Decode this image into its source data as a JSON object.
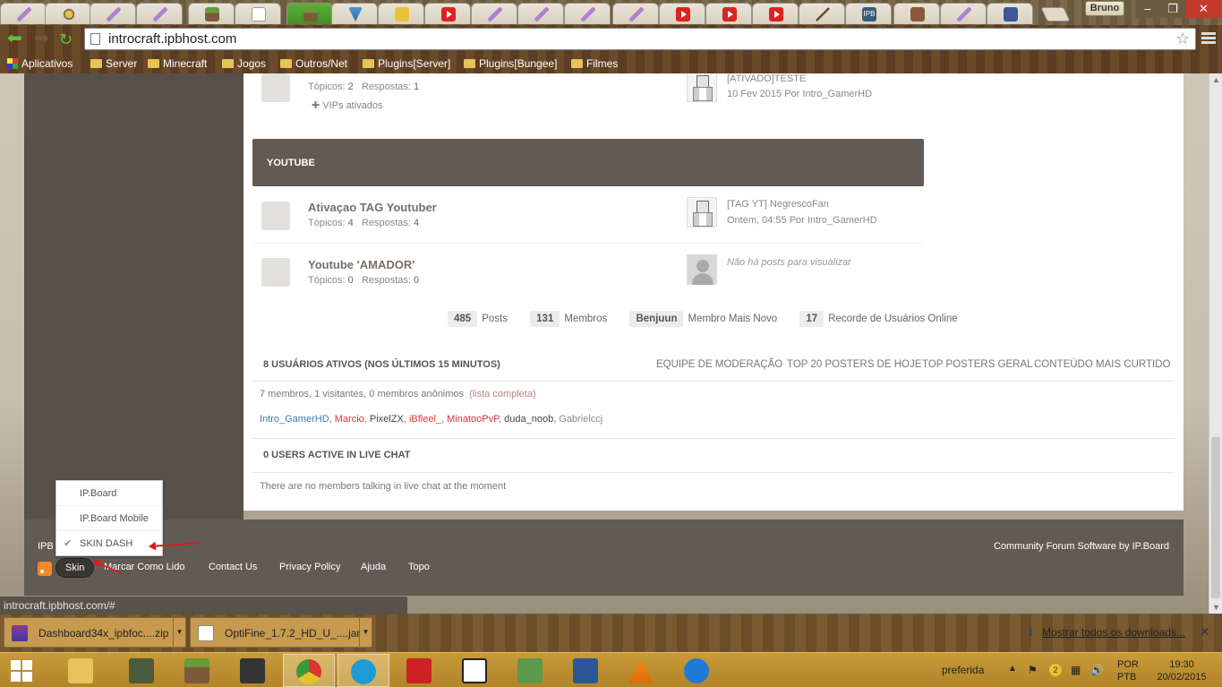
{
  "browser": {
    "profile_name": "Bruno",
    "url": "introcraft.ipbhost.com",
    "bookmarks": [
      "Aplicativos",
      "Server",
      "Minecraft",
      "Jogos",
      "Outros/Net",
      "Plugins[Server]",
      "Plugins[Bungee]",
      "Filmes"
    ],
    "status_url": "introcraft.ipbhost.com/#"
  },
  "forums_top": {
    "stats": {
      "topics_label": "Tópicos:",
      "topics": "2",
      "replies_label": "Respostas:",
      "replies": "1"
    },
    "subforum": "VIPs ativados",
    "last_title": "[ATIVADO]TESTE",
    "last_date": "10 Fev 2015",
    "last_by": "Por",
    "last_author": "Intro_GamerHD"
  },
  "youtube_section": {
    "header": "YOUTUBE",
    "forums": [
      {
        "title": "Ativaçao TAG Youtuber",
        "topics": "4",
        "replies": "4",
        "last_title": "[TAG YT] NegrescoFan",
        "last_date": "Ontem, 04:55",
        "last_by": "Por",
        "last_author": "Intro_GamerHD"
      },
      {
        "title": "Youtube 'AMADOR'",
        "topics": "0",
        "replies": "0",
        "last_title": "Não há posts para visualizar"
      }
    ],
    "topics_label": "Tópicos:",
    "replies_label": "Respostas:"
  },
  "board_stats": [
    {
      "value": "485",
      "label": "Posts"
    },
    {
      "value": "131",
      "label": "Membros"
    },
    {
      "value": "Benjuun",
      "label": "Membro Mais Novo"
    },
    {
      "value": "17",
      "label": "Recorde de Usuários Online"
    }
  ],
  "active_users": {
    "title": "8 USUÁRIOS ATIVOS (NOS ÚLTIMOS 15 MINUTOS)",
    "links": [
      "EQUIPE DE MODERAÇÃO",
      "TOP 20 POSTERS DE HOJE",
      "TOP POSTERS GERAL",
      "CONTEÚDO MAIS CURTIDO"
    ],
    "summary": "7 membros, 1 visitantes, 0 membros anônimos",
    "full_list": "(lista completa)",
    "users": [
      "Intro_GamerHD",
      "Marcio",
      "PixelZX",
      "iBfleel_",
      "MinatooPvP",
      "duda_noob",
      "Gabrielccj"
    ]
  },
  "live_chat": {
    "title": "0 USERS ACTIVE IN LIVE CHAT",
    "text": "There are no members talking in live chat at the moment"
  },
  "footer": {
    "ipb": "IPB",
    "credit": "Community Forum Software by IP.Board",
    "skin_label": "Skin",
    "links": [
      "Marcar Como Lido",
      "Contact Us",
      "Privacy Policy",
      "Ajuda",
      "Topo"
    ],
    "skins": [
      "IP.Board",
      "IP.Board Mobile",
      "SKIN DASH"
    ]
  },
  "downloads": {
    "items": [
      "Dashboard34x_ipbfoc....zip",
      "OptiFine_1.7.2_HD_U_....jar"
    ],
    "show_all": "Mostrar todos os downloads..."
  },
  "taskbar": {
    "tray_label": "preferida",
    "badge": "2",
    "lang_top": "POR",
    "lang_bottom": "PTB",
    "time": "19:30",
    "date": "20/02/2015"
  },
  "colors": {
    "accent": "#625b54",
    "link": "#3a7ab8",
    "footer": "#625b54"
  }
}
